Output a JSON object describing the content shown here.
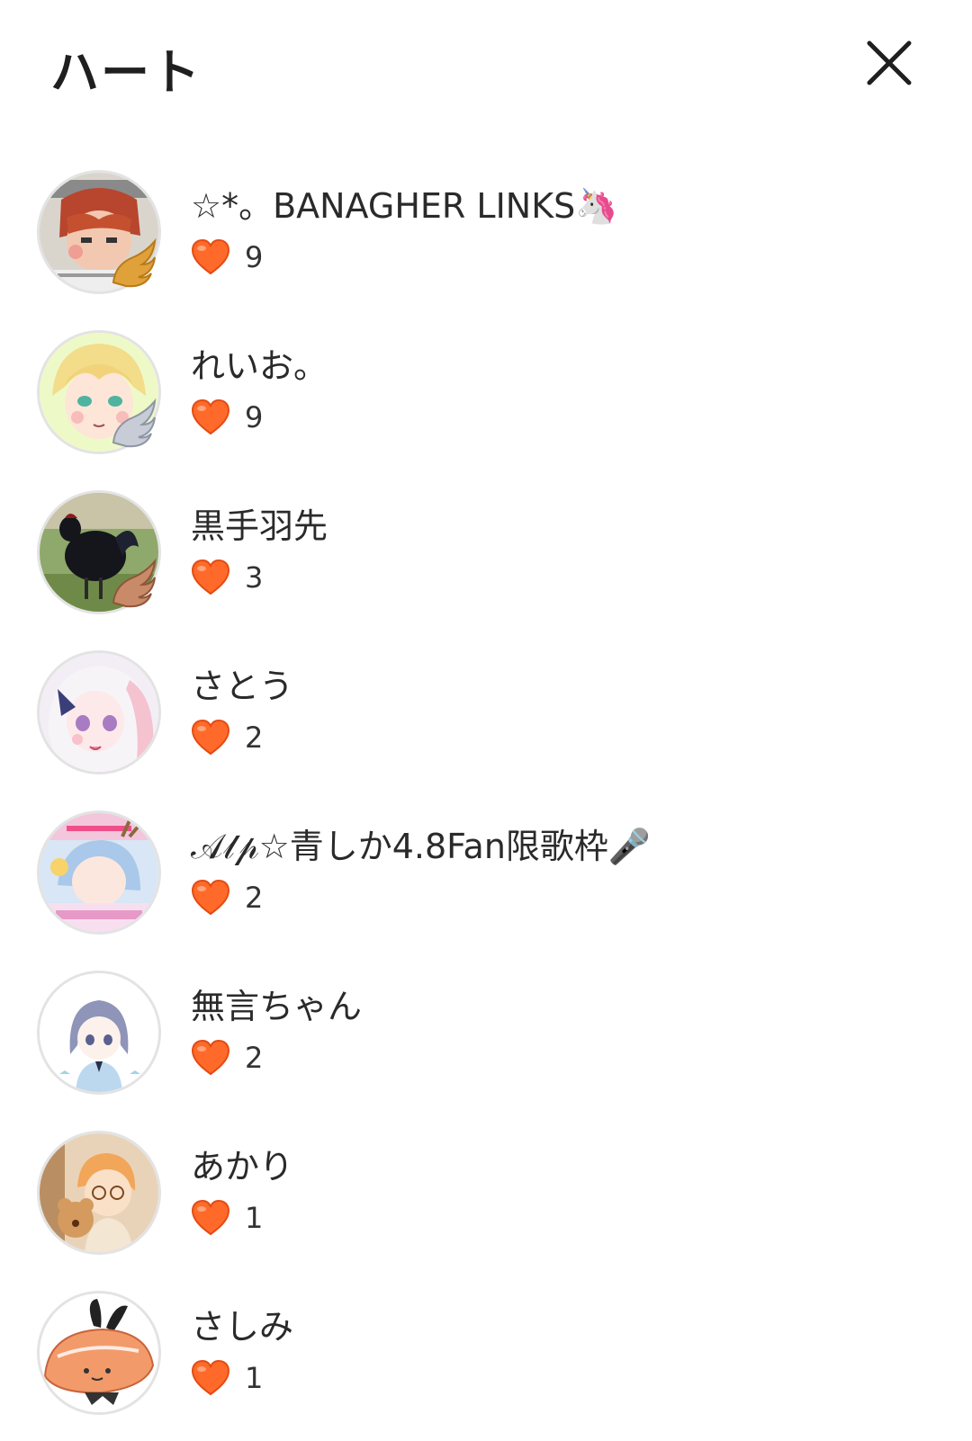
{
  "header": {
    "title": "ハート",
    "close_icon": "close-icon"
  },
  "accent_colors": {
    "heart": "#ff6a2a",
    "heart_dark": "#e44b12"
  },
  "users": [
    {
      "name": "☆*。BANAGHER LINKS🦄",
      "hearts": "9",
      "badge": "gold-wing-badge"
    },
    {
      "name": "れいお。",
      "hearts": "9",
      "badge": "silver-wing-badge"
    },
    {
      "name": "黒手羽先",
      "hearts": "3",
      "badge": "bronze-wing-badge"
    },
    {
      "name": "さとう",
      "hearts": "2"
    },
    {
      "name": "𝒜𝓁𝓅☆青しか4.8Fan限歌枠🎤",
      "hearts": "2"
    },
    {
      "name": "無言ちゃん",
      "hearts": "2"
    },
    {
      "name": "あかり",
      "hearts": "1"
    },
    {
      "name": "さしみ",
      "hearts": "1"
    }
  ]
}
